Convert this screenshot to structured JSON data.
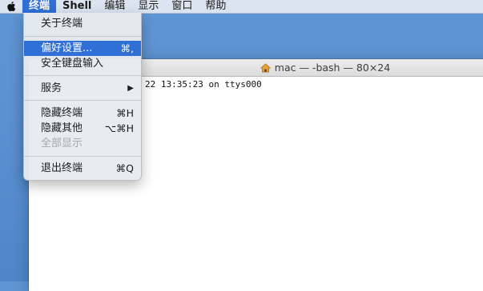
{
  "menubar": {
    "apple_icon": "apple-logo-icon",
    "items": [
      {
        "label": "终端"
      },
      {
        "label": "Shell"
      },
      {
        "label": "编辑"
      },
      {
        "label": "显示"
      },
      {
        "label": "窗口"
      },
      {
        "label": "帮助"
      }
    ]
  },
  "terminal_window": {
    "title": "mac — -bash — 80×24",
    "title_icon": "home-icon",
    "content_line": "22 13:35:23 on ttys000"
  },
  "app_menu": {
    "items": [
      {
        "label": "关于终端",
        "shortcut": ""
      },
      {
        "label": "偏好设置...",
        "shortcut": "⌘,",
        "highlighted": true
      },
      {
        "label": "安全键盘输入",
        "shortcut": ""
      },
      {
        "label": "服务",
        "shortcut": "▶"
      },
      {
        "label": "隐藏终端",
        "shortcut": "⌘H"
      },
      {
        "label": "隐藏其他",
        "shortcut": "⌥⌘H"
      },
      {
        "label": "全部显示",
        "shortcut": "",
        "disabled": true
      },
      {
        "label": "退出终端",
        "shortcut": "⌘Q"
      }
    ]
  },
  "colors": {
    "desktop": "#5b91d1",
    "highlight": "#2f6fd6",
    "menu_bg": "#e8eaee"
  }
}
